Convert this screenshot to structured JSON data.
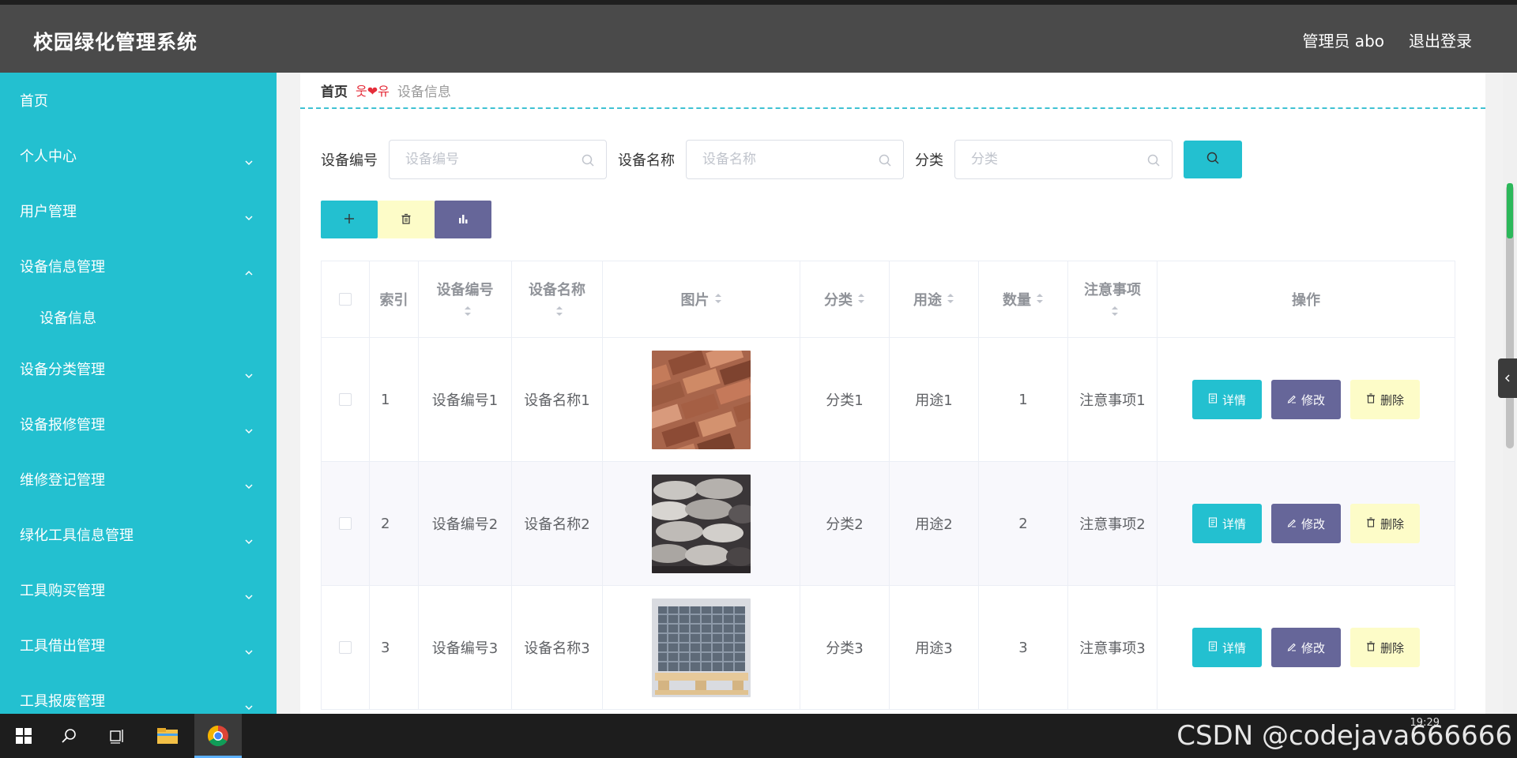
{
  "header": {
    "title": "校园绿化管理系统",
    "admin": "管理员 abo",
    "logout": "退出登录"
  },
  "sidebar": {
    "items": [
      {
        "label": "首页",
        "chevron": "none"
      },
      {
        "label": "个人中心",
        "chevron": "down"
      },
      {
        "label": "用户管理",
        "chevron": "down"
      },
      {
        "label": "设备信息管理",
        "chevron": "up"
      },
      {
        "label": "设备信息",
        "chevron": "none",
        "sub": true
      },
      {
        "label": "设备分类管理",
        "chevron": "down"
      },
      {
        "label": "设备报修管理",
        "chevron": "down"
      },
      {
        "label": "维修登记管理",
        "chevron": "down"
      },
      {
        "label": "绿化工具信息管理",
        "chevron": "down"
      },
      {
        "label": "工具购买管理",
        "chevron": "down"
      },
      {
        "label": "工具借出管理",
        "chevron": "down"
      },
      {
        "label": "工具报废管理",
        "chevron": "down"
      }
    ]
  },
  "breadcrumb": {
    "home": "首页",
    "sep": "웃❤유",
    "current": "设备信息"
  },
  "search": {
    "fields": [
      {
        "label": "设备编号",
        "placeholder": "设备编号"
      },
      {
        "label": "设备名称",
        "placeholder": "设备名称"
      },
      {
        "label": "分类",
        "placeholder": "分类"
      }
    ]
  },
  "table": {
    "headers": {
      "idx": "索引",
      "no": "设备编号",
      "name": "设备名称",
      "img": "图片",
      "cat": "分类",
      "use": "用途",
      "qty": "数量",
      "note": "注意事项",
      "ops": "操作"
    },
    "rows": [
      {
        "idx": "1",
        "no": "设备编号1",
        "name": "设备名称1",
        "cat": "分类1",
        "use": "用途1",
        "qty": "1",
        "note": "注意事项1"
      },
      {
        "idx": "2",
        "no": "设备编号2",
        "name": "设备名称2",
        "cat": "分类2",
        "use": "用途2",
        "qty": "2",
        "note": "注意事项2"
      },
      {
        "idx": "3",
        "no": "设备编号3",
        "name": "设备名称3",
        "cat": "分类3",
        "use": "用途3",
        "qty": "3",
        "note": "注意事项3"
      }
    ],
    "actions": {
      "detail": "详情",
      "edit": "修改",
      "remove": "删除"
    }
  },
  "taskbar": {
    "clock": "19:29",
    "watermark": "CSDN @codejava666666"
  },
  "colors": {
    "primary": "#23c0d0",
    "purple": "#666699",
    "yellow": "#fdfcc8",
    "header": "#4a4a4a"
  }
}
